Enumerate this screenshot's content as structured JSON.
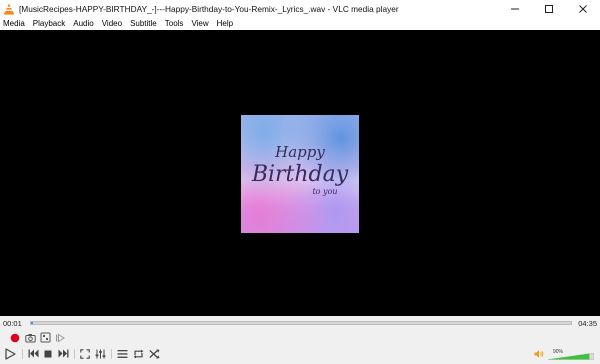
{
  "window": {
    "title": "[MusicRecipes-HAPPY-BIRTHDAY_-]---Happy-Birthday-to-You-Remix-_Lyrics_.wav - VLC media player"
  },
  "menu": {
    "items": [
      "Media",
      "Playback",
      "Audio",
      "Video",
      "Subtitle",
      "Tools",
      "View",
      "Help"
    ]
  },
  "artwork": {
    "line1": "Happy",
    "line2": "Birthday",
    "line3": "to you"
  },
  "player": {
    "elapsed": "00:01",
    "total": "04:35",
    "progress": 0.004,
    "volume_label": "90%",
    "volume": 0.9
  },
  "colors": {
    "accent": "#4a90e2",
    "record": "#e0001b",
    "volume_fill": "#3cc23c"
  }
}
